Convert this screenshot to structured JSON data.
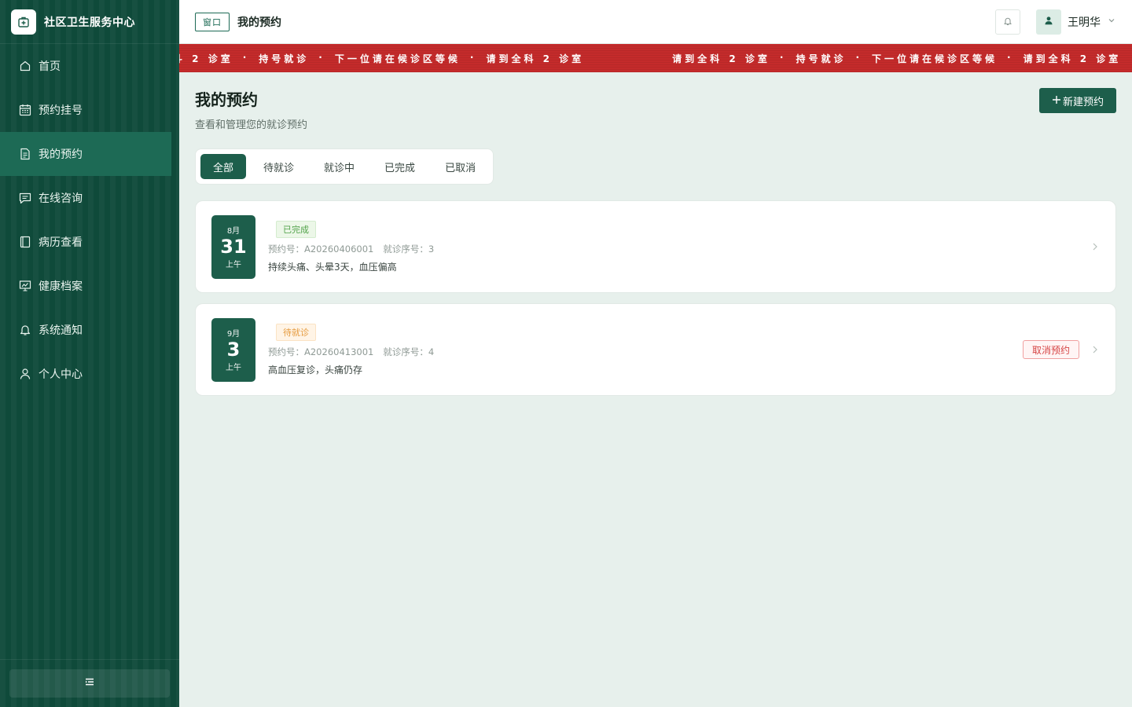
{
  "brand": {
    "name": "社区卫生服务中心",
    "logo_icon": "medical-case-icon"
  },
  "sidebar": {
    "items": [
      {
        "label": "首页",
        "icon": "home-icon",
        "active": false
      },
      {
        "label": "预约挂号",
        "icon": "calendar-icon",
        "active": false
      },
      {
        "label": "我的预约",
        "icon": "document-icon",
        "active": true
      },
      {
        "label": "在线咨询",
        "icon": "chat-icon",
        "active": false
      },
      {
        "label": "病历查看",
        "icon": "book-icon",
        "active": false
      },
      {
        "label": "健康档案",
        "icon": "chart-board-icon",
        "active": false
      },
      {
        "label": "系统通知",
        "icon": "bell-icon",
        "active": false
      },
      {
        "label": "个人中心",
        "icon": "user-icon",
        "active": false
      }
    ],
    "collapse_icon": "menu-collapse-icon"
  },
  "topbar": {
    "window_tag": "窗口",
    "title": "我的预约",
    "user_name": "王明华"
  },
  "ticker": {
    "items": [
      "请到全科 2 诊室",
      "持号就诊",
      "下一位请在候诊区等候"
    ],
    "separator": "·"
  },
  "page": {
    "title": "我的预约",
    "subtitle": "查看和管理您的就诊预约",
    "new_button": "新建预约"
  },
  "tabs": [
    "全部",
    "待就诊",
    "就诊中",
    "已完成",
    "已取消"
  ],
  "appointments": [
    {
      "month": "8月",
      "day": "31",
      "period": "上午",
      "status": "已完成",
      "status_type": "done",
      "appt_no_label": "预约号：",
      "appt_no": "A20260406001",
      "seq_label": "就诊序号：",
      "seq": "3",
      "desc": "持续头痛、头晕3天，血压偏高",
      "cancel": ""
    },
    {
      "month": "9月",
      "day": "3",
      "period": "上午",
      "status": "待就诊",
      "status_type": "pending",
      "appt_no_label": "预约号：",
      "appt_no": "A20260413001",
      "seq_label": "就诊序号：",
      "seq": "4",
      "desc": "高血压复诊，头痛仍存",
      "cancel": "取消预约"
    }
  ],
  "colors": {
    "primary": "#1d5e4b",
    "sidebar": "#0f4a3a",
    "ticker": "#c42b2b",
    "done": "#52a34a",
    "pending": "#e59a3d",
    "danger": "#d64545"
  }
}
